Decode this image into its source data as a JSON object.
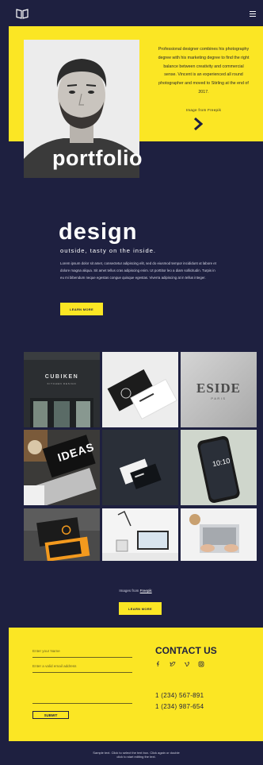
{
  "header": {
    "logo_icon": "open-book-icon",
    "menu_icon": "hamburger-menu-icon"
  },
  "hero": {
    "text": "Professional designer combines his photography degree with his marketing degree to find the right balance between creativity and commercial sense. Vincent is an experienced all round photographer and moved to Stirling at the end of 2017.",
    "credit": "Image from Freepik",
    "chevron_icon": "chevron-right-icon",
    "title": "portfolio"
  },
  "design": {
    "title": "design",
    "subtitle": "outside, tasty on the inside.",
    "body": "Lorem ipsum dolor sit amet, consectetur adipiscing elit, sed do eiusmod tempor incididunt ut labore et dolore magna aliqua. Sit amet tellus cras adipiscing enim. Ut porttitor leo a diam sollicitudin. Turpis in eu mi bibendum neque egestas congue quisque egestas. Viverra adipiscing at in tellus integer.",
    "button": "LEARN MORE"
  },
  "gallery": {
    "tiles": [
      {
        "name": "cubiken-storefront",
        "text": "CUBIKEN",
        "subtext": "KITCHEN DESIGN"
      },
      {
        "name": "business-cards",
        "text": ""
      },
      {
        "name": "eside-sign",
        "text": "ESIDE",
        "subtext": "PARIS"
      },
      {
        "name": "ideas-laptop",
        "text": "IDEAS"
      },
      {
        "name": "dark-cards",
        "text": ""
      },
      {
        "name": "smartphone",
        "text": "10:10"
      },
      {
        "name": "orange-cards",
        "text": ""
      },
      {
        "name": "desk-setup",
        "text": ""
      },
      {
        "name": "laptop-hands",
        "text": ""
      }
    ],
    "credit_prefix": "Images from ",
    "credit_link": "Freepik",
    "button": "LEARN MORE"
  },
  "contact": {
    "name_placeholder": "Enter your Name",
    "email_placeholder": "Enter a valid email address",
    "message_placeholder": "",
    "submit": "SUBMIT",
    "title": "CONTACT US",
    "social": [
      "facebook-icon",
      "twitter-icon",
      "vimeo-icon",
      "instagram-icon"
    ],
    "phone1": "1 (234) 567-891",
    "phone2": "1 (234) 987-654"
  },
  "footer": {
    "text": "Sample text. Click to select the text box. Click again or double click to start editing the text."
  },
  "colors": {
    "navy": "#1e2040",
    "yellow": "#fbe624"
  }
}
